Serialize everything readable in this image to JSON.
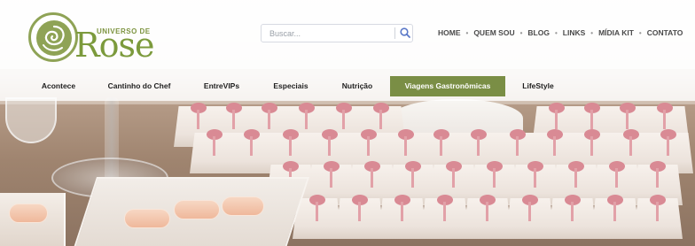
{
  "logo": {
    "small_text": "UNIVERSO DE",
    "big_text": "Rose"
  },
  "search": {
    "placeholder": "Buscar..."
  },
  "top_nav": [
    "HOME",
    "QUEM SOU",
    "BLOG",
    "LINKS",
    "MÍDIA KIT",
    "CONTATO"
  ],
  "categories": [
    {
      "label": "Acontece",
      "active": false
    },
    {
      "label": "Cantinho do Chef",
      "active": false
    },
    {
      "label": "EntreVIPs",
      "active": false
    },
    {
      "label": "Especiais",
      "active": false
    },
    {
      "label": "Nutrição",
      "active": false
    },
    {
      "label": "Viagens Gastronômicas",
      "active": true
    },
    {
      "label": "LifeStyle",
      "active": false
    }
  ],
  "colors": {
    "brand_green": "#7a8e45",
    "logo_green": "#7c9a3c",
    "ribbon_pink": "#d98a94"
  },
  "icons": {
    "search": "search-icon",
    "logo": "rose-logo-icon"
  }
}
